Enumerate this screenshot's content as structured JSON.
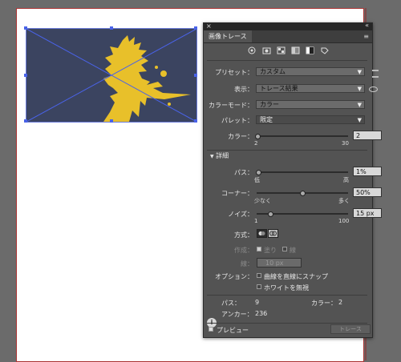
{
  "panel": {
    "close_glyph": "×",
    "collapse_glyph": "«",
    "tab_title": "画像トレース",
    "menu_glyph": "≡",
    "icons": [
      "auto-color-icon",
      "high-color-icon",
      "low-color-icon",
      "grayscale-icon",
      "black-white-icon",
      "outline-icon"
    ],
    "preset": {
      "label": "プリセット：",
      "value": "カスタム"
    },
    "view": {
      "label": "表示：",
      "value": "トレース結果"
    },
    "color_mode": {
      "label": "カラーモード：",
      "value": "カラー"
    },
    "palette": {
      "label": "パレット：",
      "value": "限定"
    },
    "colors": {
      "label": "カラー：",
      "value": "2",
      "min": "2",
      "max": "30",
      "level": 0
    },
    "advanced": {
      "label": "詳細",
      "disclosure_glyph": "▼"
    },
    "paths": {
      "label": "パス：",
      "value": "1%",
      "min": "低",
      "max": "高",
      "level": 0.01
    },
    "corners": {
      "label": "コーナー：",
      "value": "50%",
      "min": "少なく",
      "max": "多く",
      "level": 0.5
    },
    "noise": {
      "label": "ノイズ：",
      "value": "15 px",
      "min": "1",
      "max": "100",
      "level": 0.14
    },
    "method": {
      "label": "方式："
    },
    "create": {
      "label": "作成：",
      "fill": "塗り",
      "stroke": "線",
      "fill_checked": true,
      "stroke_checked": false
    },
    "stroke": {
      "label": "線：",
      "value": "10 px"
    },
    "options": {
      "label": "オプション：",
      "snap": "曲線を直線にスナップ",
      "ignore_white": "ホワイトを無視",
      "snap_checked": false,
      "ignore_white_checked": false
    },
    "stats": {
      "paths_label": "パス：",
      "paths_value": "9",
      "colors_label": "カラー：",
      "colors_value": "2",
      "anchors_label": "アンカー：",
      "anchors_value": "236"
    },
    "info_glyph": "i",
    "preview": {
      "label": "プレビュー",
      "checked": true
    },
    "trace_button": "トレース"
  },
  "colors": {
    "image_bg": "#3b4460",
    "splat": "#e8c02a",
    "selection": "#4a63e8"
  }
}
